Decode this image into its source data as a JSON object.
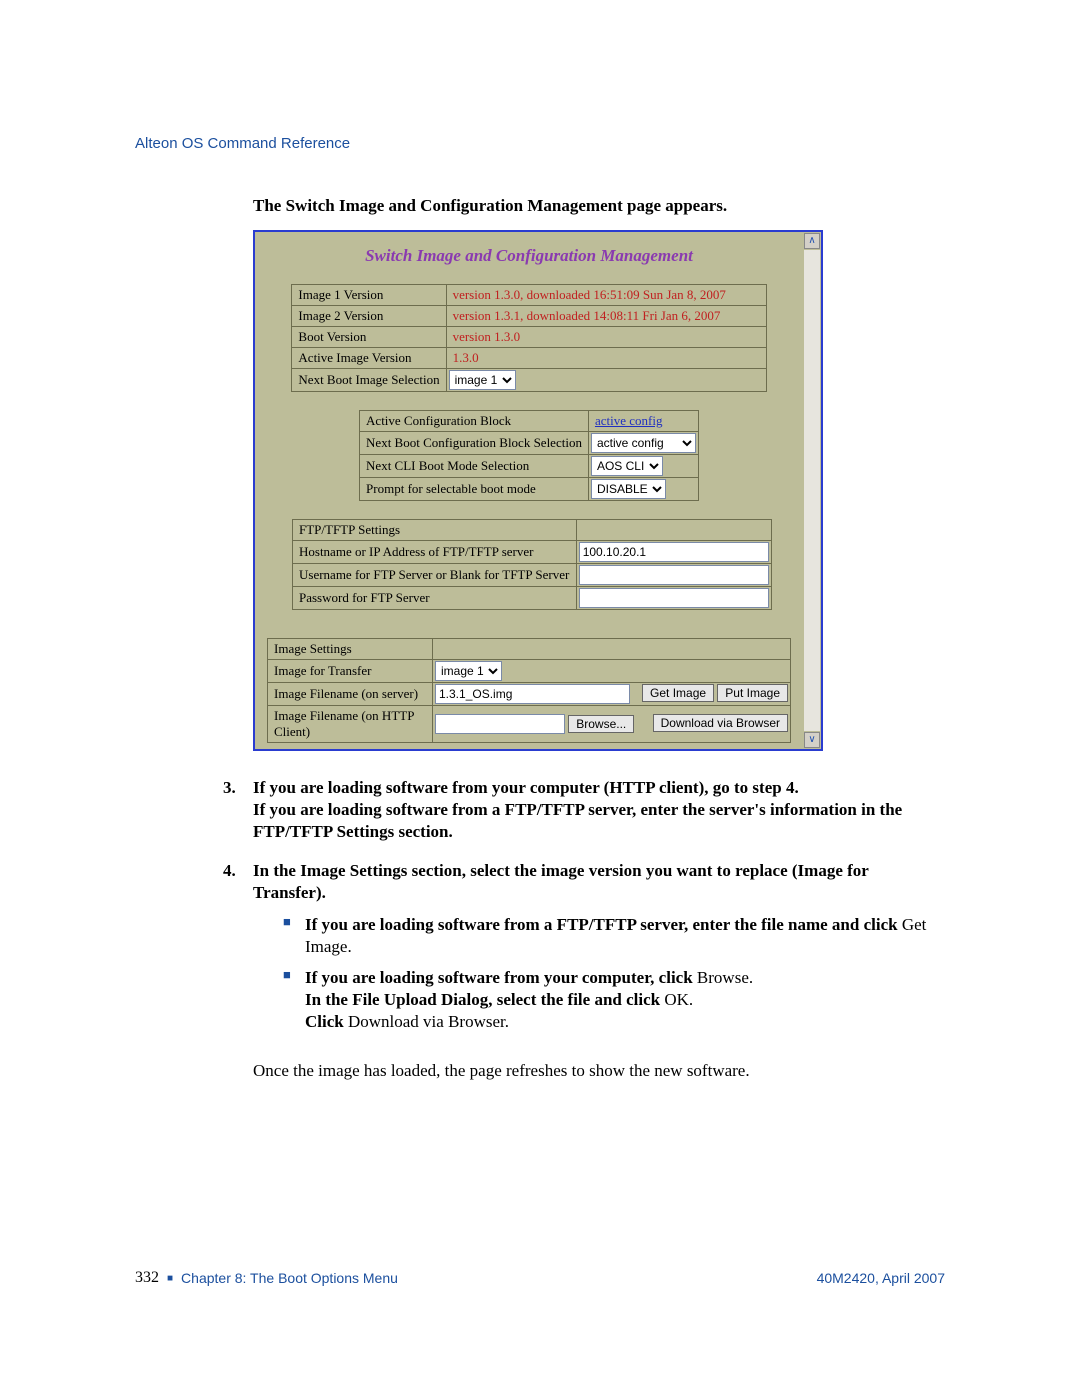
{
  "header": {
    "doc_title": "Alteon OS Command Reference"
  },
  "intro": "The Switch Image and Configuration Management page appears.",
  "panel": {
    "title": "Switch Image and Configuration Management",
    "versions": {
      "rows": [
        {
          "label": "Image 1 Version",
          "value": "version 1.3.0, downloaded 16:51:09 Sun Jan 8, 2007"
        },
        {
          "label": "Image 2 Version",
          "value": "version 1.3.1, downloaded 14:08:11 Fri Jan 6, 2007"
        },
        {
          "label": "Boot Version",
          "value": "version 1.3.0"
        },
        {
          "label": "Active Image Version",
          "value": "1.3.0"
        }
      ],
      "next_boot_label": "Next Boot Image Selection",
      "next_boot_value": "image 1"
    },
    "config": {
      "rows": {
        "active_label": "Active Configuration Block",
        "active_value": "active config",
        "next_block_label": "Next Boot Configuration Block Selection",
        "next_block_value": "active config",
        "cli_label": "Next CLI Boot Mode Selection",
        "cli_value": "AOS CLI",
        "prompt_label": "Prompt for selectable boot mode",
        "prompt_value": "DISABLE"
      }
    },
    "ftp": {
      "header": "FTP/TFTP Settings",
      "host_label": "Hostname or IP Address of FTP/TFTP server",
      "host_value": "100.10.20.1",
      "user_label": "Username for FTP Server or Blank for TFTP Server",
      "pass_label": "Password for FTP Server"
    },
    "image": {
      "header": "Image Settings",
      "transfer_label": "Image for Transfer",
      "transfer_value": "image 1",
      "file_server_label": "Image Filename (on server)",
      "file_server_value": "1.3.1_OS.img",
      "get_btn": "Get Image",
      "put_btn": "Put Image",
      "file_http_label": "Image Filename (on HTTP Client)",
      "browse_btn": "Browse...",
      "download_btn": "Download via Browser"
    }
  },
  "steps": {
    "s3num": "3.",
    "s3a": "If you are loading software from your computer (HTTP client), go to step 4.",
    "s3b": "If you are loading software from a FTP/TFTP server, enter the server's information in the FTP/TFTP Settings section.",
    "s4num": "4.",
    "s4a": "In the Image Settings section, select the image version you want to replace (Image for Transfer).",
    "b1a": "If you are loading software from a FTP/TFTP server, enter the file name and click ",
    "b1b": "Get Image.",
    "b2a": "If you are loading software from your computer, click ",
    "b2b": "Browse.",
    "b2c": "In the File Upload Dialog, select the file and click ",
    "b2d": "OK.",
    "b2e": "Click ",
    "b2f": "Download via Browser.",
    "follow": "Once the image has loaded, the page refreshes to show the new software."
  },
  "footer": {
    "page": "332",
    "chapter": "Chapter 8:  The Boot Options Menu",
    "docid": "40M2420, April 2007"
  }
}
